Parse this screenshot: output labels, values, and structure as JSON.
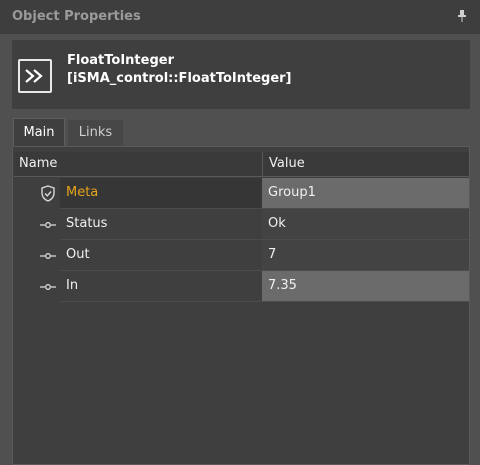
{
  "window": {
    "title": "Object Properties"
  },
  "component": {
    "name": "FloatToInteger",
    "type": "[iSMA_control::FloatToInteger]",
    "icon": "arrow-forward-icon"
  },
  "tabs": [
    {
      "label": "Main",
      "active": true
    },
    {
      "label": "Links",
      "active": false
    }
  ],
  "grid": {
    "columns": [
      "Name",
      "Value"
    ],
    "rows": [
      {
        "name": "Meta",
        "value": "Group1",
        "icon": "shield-check-icon"
      },
      {
        "name": "Status",
        "value": "Ok",
        "icon": "slot-icon"
      },
      {
        "name": "Out",
        "value": "7",
        "icon": "slot-icon"
      },
      {
        "name": "In",
        "value": "7.35",
        "icon": "slot-icon"
      }
    ]
  },
  "colors": {
    "meta_label": "#e3a31b",
    "background": "#505050",
    "panel": "#3f3f3f"
  }
}
